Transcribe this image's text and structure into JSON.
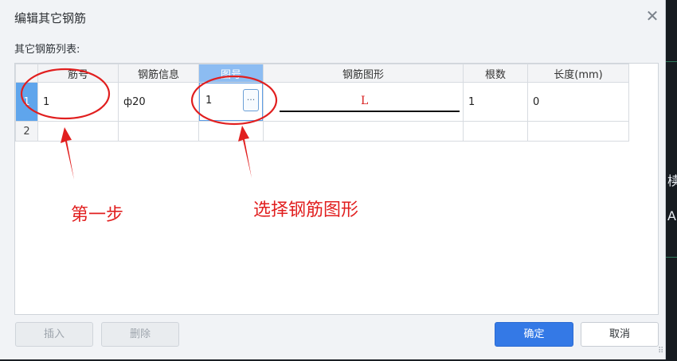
{
  "window": {
    "title": "编辑其它钢筋"
  },
  "list_label": "其它钢筋列表:",
  "table": {
    "headers": [
      "",
      "筋号",
      "钢筋信息",
      "图号",
      "钢筋图形",
      "根数",
      "长度(mm)"
    ],
    "rows": [
      {
        "num": "1",
        "jinhao": "1",
        "info": "ф20",
        "tuhao": "1",
        "figure": "L",
        "count": "1",
        "length": "0"
      },
      {
        "num": "2",
        "jinhao": "",
        "info": "",
        "tuhao": "",
        "figure": "",
        "count": "",
        "length": ""
      }
    ]
  },
  "buttons": {
    "insert": "插入",
    "delete": "删除",
    "ok": "确定",
    "cancel": "取消"
  },
  "annotations": {
    "step_one": "第一步",
    "choose_shape": "选择钢筋图形"
  },
  "background": {
    "glyph_top": "椟",
    "glyph_bottom": "A"
  },
  "colors": {
    "accent": "#3479e6",
    "annotation": "#e11f1f",
    "header_active": "#8cbcf2"
  }
}
